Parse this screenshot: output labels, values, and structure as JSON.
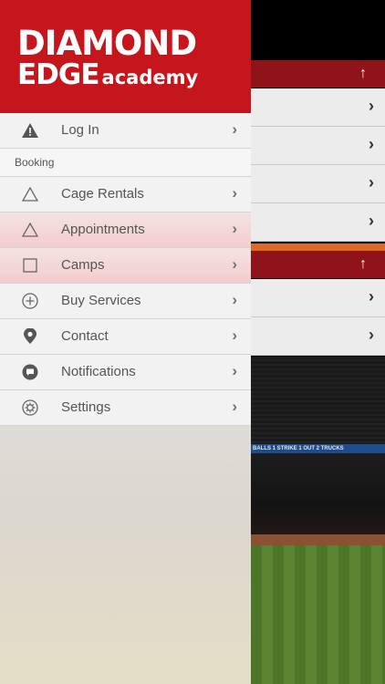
{
  "app": {
    "logo_line1": "DIAMOND",
    "logo_line2": "EDGE",
    "logo_sub": "academy"
  },
  "menu": {
    "login": {
      "label": "Log In",
      "icon": "warning-icon"
    },
    "section_booking": "Booking",
    "items": [
      {
        "label": "Cage Rentals",
        "icon": "triangle-outline-icon"
      },
      {
        "label": "Appointments",
        "icon": "triangle-outline-icon"
      },
      {
        "label": "Camps",
        "icon": "square-outline-icon"
      },
      {
        "label": "Buy Services",
        "icon": "plus-circle-icon"
      },
      {
        "label": "Contact",
        "icon": "location-pin-icon"
      },
      {
        "label": "Notifications",
        "icon": "chat-bubble-icon"
      },
      {
        "label": "Settings",
        "icon": "gear-icon"
      }
    ],
    "chevron": "›"
  },
  "background": {
    "header_arrow": "↑",
    "led_text": "BALLS 1 STRIKE 1 OUT 2 TRUCKS"
  },
  "colors": {
    "brand_red": "#c4161c",
    "dark_red": "#8f1319",
    "orange": "#e06a1f"
  }
}
